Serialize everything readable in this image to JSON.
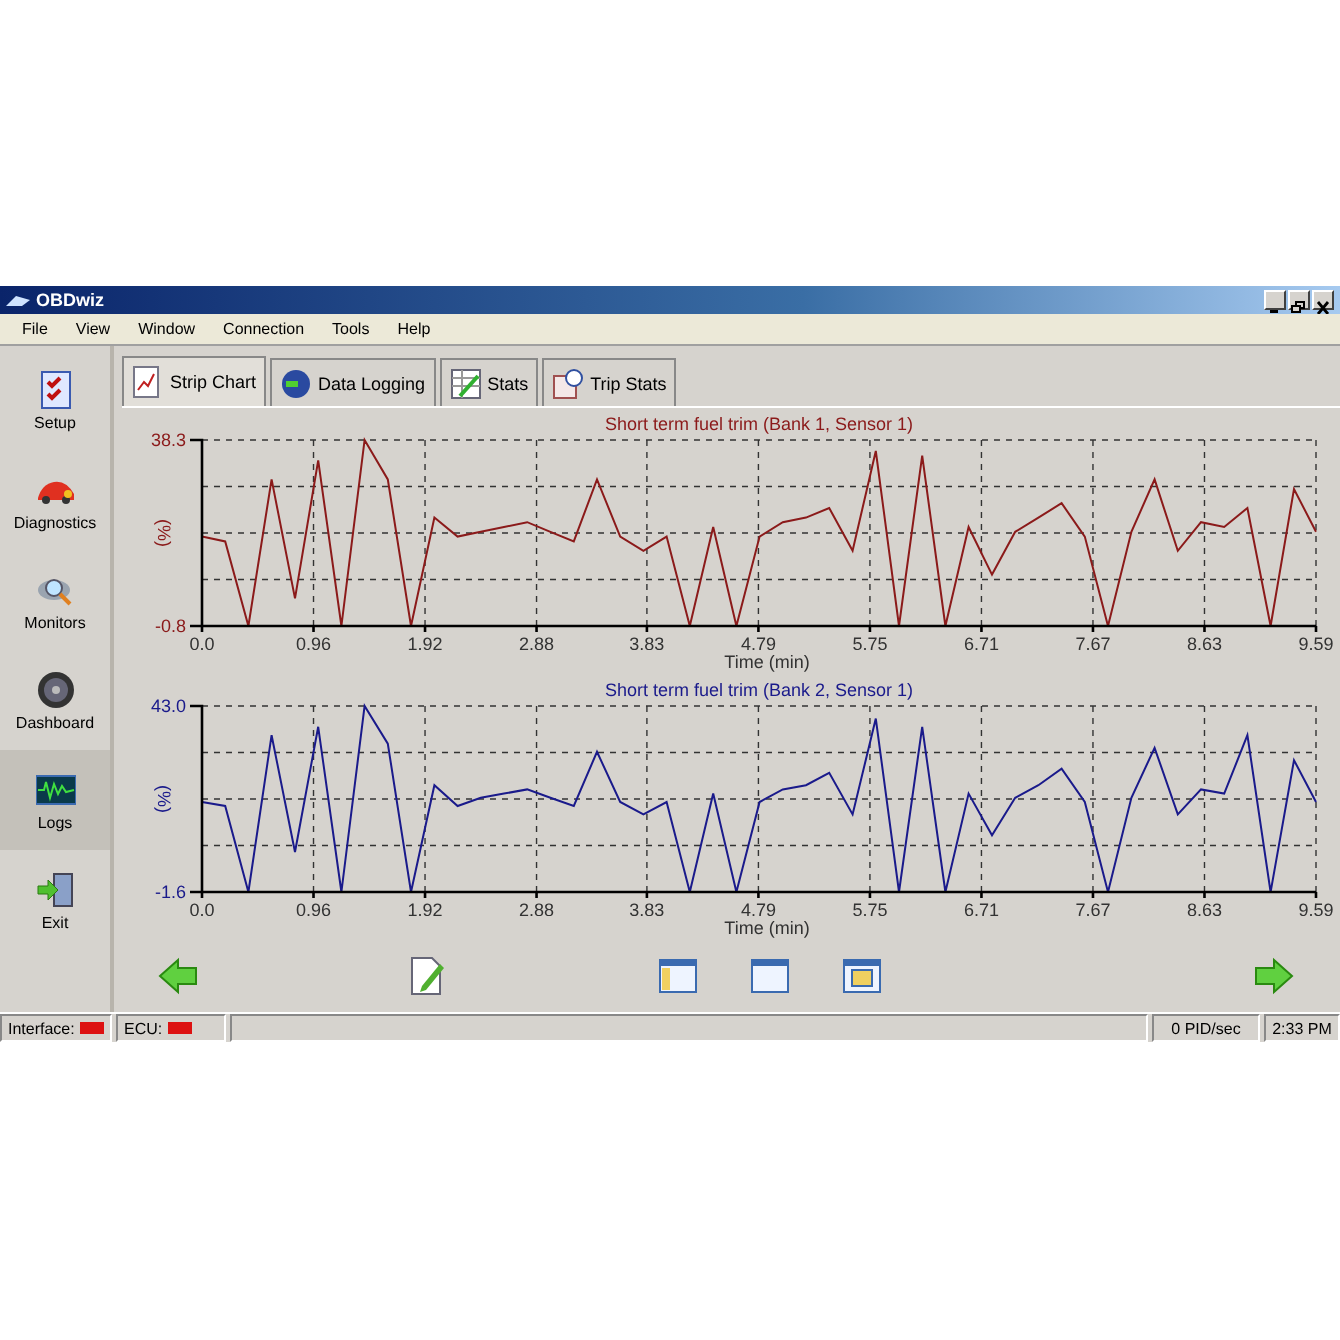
{
  "window": {
    "title": "OBDwiz"
  },
  "menu": [
    "File",
    "View",
    "Window",
    "Connection",
    "Tools",
    "Help"
  ],
  "sidebar": {
    "items": [
      {
        "label": "Setup",
        "selected": false
      },
      {
        "label": "Diagnostics",
        "selected": false
      },
      {
        "label": "Monitors",
        "selected": false
      },
      {
        "label": "Dashboard",
        "selected": false
      },
      {
        "label": "Logs",
        "selected": true
      },
      {
        "label": "Exit",
        "selected": false
      }
    ]
  },
  "tabs": [
    {
      "label": "Strip Chart",
      "selected": true
    },
    {
      "label": "Data Logging",
      "selected": false
    },
    {
      "label": "Stats",
      "selected": false
    },
    {
      "label": "Trip Stats",
      "selected": false
    }
  ],
  "charts": [
    {
      "unit": "(%)",
      "chart_data": {
        "type": "line",
        "title": "Short term fuel trim (Bank 1, Sensor 1)",
        "xlabel": "Time (min)",
        "ylim": [
          -0.8,
          38.3
        ],
        "yticks": [
          38.3,
          -0.8
        ],
        "xlim": [
          0,
          9.59
        ],
        "xticks": [
          {
            "value": 0,
            "label": "0.0"
          },
          0.96,
          1.92,
          2.88,
          3.83,
          4.79,
          5.75,
          6.71,
          7.67,
          8.63,
          9.59
        ],
        "x": [
          0,
          0.2,
          0.4,
          0.6,
          0.8,
          1,
          1.2,
          1.4,
          1.6,
          1.8,
          2,
          2.2,
          2.4,
          2.6,
          2.8,
          3,
          3.2,
          3.4,
          3.6,
          3.8,
          4,
          4.2,
          4.4,
          4.6,
          4.8,
          5,
          5.2,
          5.4,
          5.6,
          5.8,
          6,
          6.2,
          6.4,
          6.6,
          6.8,
          7,
          7.2,
          7.4,
          7.6,
          7.8,
          8,
          8.2,
          8.4,
          8.6,
          8.8,
          9,
          9.2,
          9.4,
          9.59
        ],
        "grid": true,
        "series": [
          {
            "color": "#8b1a1a",
            "values": [
              18,
              17,
              -0.8,
              30,
              5,
              34,
              -0.8,
              38.3,
              30,
              -0.8,
              22,
              18,
              19,
              20,
              21,
              19,
              17,
              30,
              18,
              15,
              18,
              -0.8,
              20,
              -0.8,
              18,
              21,
              22,
              24,
              15,
              36,
              -0.8,
              35,
              -0.8,
              20,
              10,
              19,
              22,
              25,
              18,
              -0.8,
              19,
              30,
              15,
              21,
              20,
              24,
              -0.8,
              28,
              19
            ]
          }
        ]
      }
    },
    {
      "unit": "(%)",
      "chart_data": {
        "type": "line",
        "title": "Short term fuel trim (Bank 2, Sensor 1)",
        "xlabel": "Time (min)",
        "ylim": [
          -1.6,
          43
        ],
        "yticks": [
          {
            "value": 43,
            "label": "43.0"
          },
          -1.6
        ],
        "xlim": [
          0,
          9.59
        ],
        "xticks": [
          {
            "value": 0,
            "label": "0.0"
          },
          0.96,
          1.92,
          2.88,
          3.83,
          4.79,
          5.75,
          6.71,
          7.67,
          8.63,
          9.59
        ],
        "x": [
          0,
          0.2,
          0.4,
          0.6,
          0.8,
          1,
          1.2,
          1.4,
          1.6,
          1.8,
          2,
          2.2,
          2.4,
          2.6,
          2.8,
          3,
          3.2,
          3.4,
          3.6,
          3.8,
          4,
          4.2,
          4.4,
          4.6,
          4.8,
          5,
          5.2,
          5.4,
          5.6,
          5.8,
          6,
          6.2,
          6.4,
          6.6,
          6.8,
          7,
          7.2,
          7.4,
          7.6,
          7.8,
          8,
          8.2,
          8.4,
          8.6,
          8.8,
          9,
          9.2,
          9.4,
          9.59
        ],
        "grid": true,
        "series": [
          {
            "color": "#1a1a8b",
            "values": [
              20,
              19,
              -1.6,
              36,
              8,
              38,
              -1.6,
              43,
              34,
              -1.6,
              24,
              19,
              21,
              22,
              23,
              21,
              19,
              32,
              20,
              17,
              20,
              -1.6,
              22,
              -1.6,
              20,
              23,
              24,
              27,
              17,
              40,
              -1.6,
              38,
              -1.6,
              22,
              12,
              21,
              24,
              28,
              20,
              -1.6,
              21,
              33,
              17,
              23,
              22,
              36,
              -1.6,
              30,
              20
            ]
          }
        ]
      }
    }
  ],
  "status_bar": {
    "indicators": [
      {
        "label": "Interface:",
        "color": "#dd1111"
      },
      {
        "label": "ECU:",
        "color": "#dd1111"
      }
    ],
    "rate": "0 PID/sec",
    "time": "2:33 PM"
  }
}
